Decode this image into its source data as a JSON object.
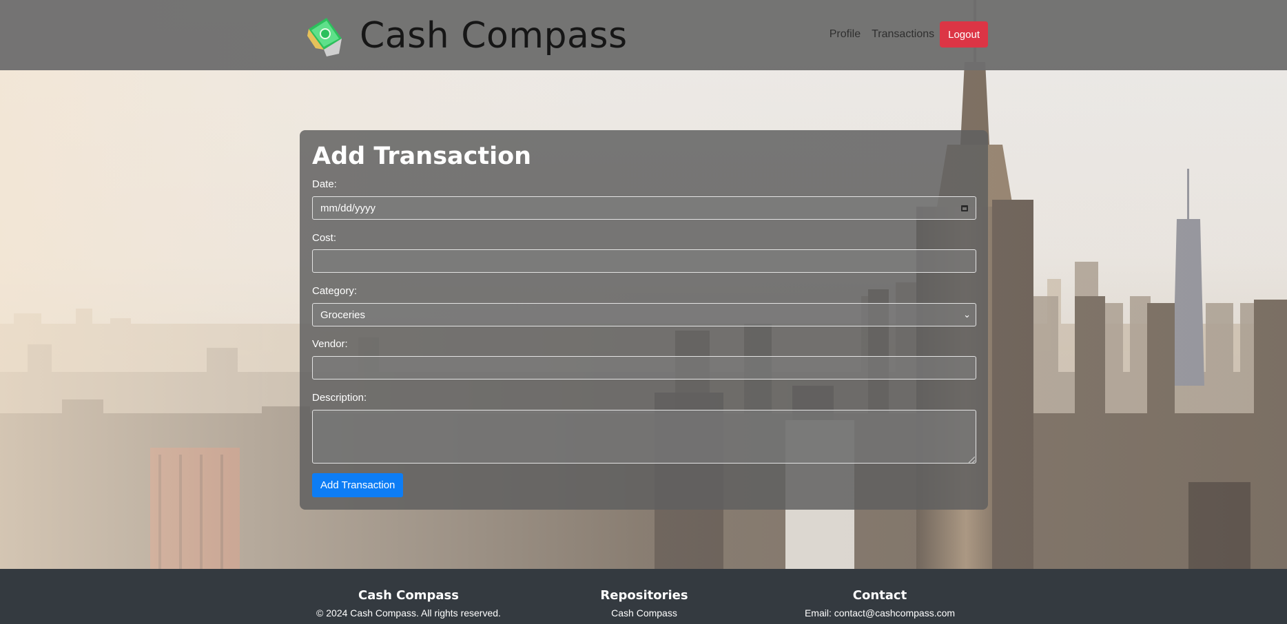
{
  "header": {
    "brand": "Cash Compass",
    "logo_icon": "money-compass-logo-icon",
    "nav": {
      "profile": "Profile",
      "transactions": "Transactions",
      "logout": "Logout"
    }
  },
  "form": {
    "title": "Add Transaction",
    "date_label": "Date:",
    "date_placeholder": "mm/dd/yyyy",
    "cost_label": "Cost:",
    "cost_value": "",
    "category_label": "Category:",
    "category_selected": "Groceries",
    "vendor_label": "Vendor:",
    "vendor_value": "",
    "description_label": "Description:",
    "description_value": "",
    "submit_label": "Add Transaction"
  },
  "footer": {
    "col1": {
      "heading": "Cash Compass",
      "text": "© 2024 Cash Compass. All rights reserved."
    },
    "col2": {
      "heading": "Repositories",
      "text": "Cash Compass"
    },
    "col3": {
      "heading": "Contact",
      "text": "Email: contact@cashcompass.com"
    }
  },
  "colors": {
    "header_bg": "#6e6e6e",
    "logout_btn": "#dc3545",
    "submit_btn": "#0d7df5",
    "footer_bg": "#343a40"
  }
}
